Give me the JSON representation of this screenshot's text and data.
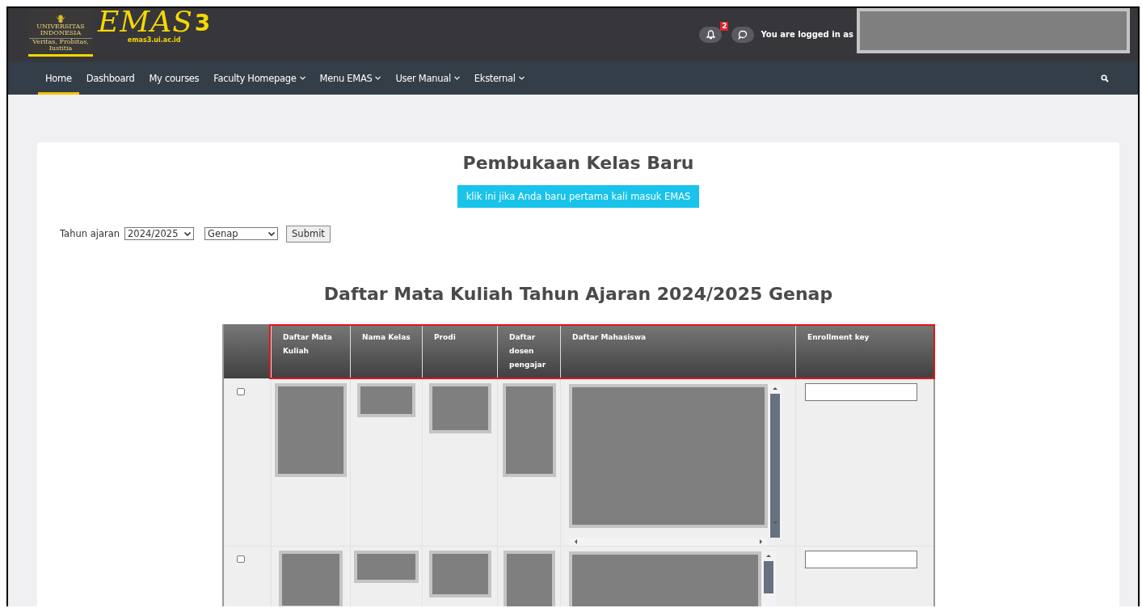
{
  "header": {
    "emblem_lines": [
      "UNIVERSITAS INDONESIA",
      "Veritas, Probitas, Iustitia"
    ],
    "logo_text": "EMAS",
    "logo_number": "3",
    "logo_url": "emas3.ui.ac.id",
    "notification_count": "2",
    "login_text": "You are logged in as"
  },
  "nav": {
    "items": [
      {
        "label": "Home",
        "selected": true,
        "has_dropdown": false
      },
      {
        "label": "Dashboard",
        "selected": false,
        "has_dropdown": false
      },
      {
        "label": "My courses",
        "selected": false,
        "has_dropdown": false
      },
      {
        "label": "Faculty Homepage",
        "selected": false,
        "has_dropdown": true
      },
      {
        "label": "Menu EMAS",
        "selected": false,
        "has_dropdown": true
      },
      {
        "label": "User Manual",
        "selected": false,
        "has_dropdown": true
      },
      {
        "label": "Eksternal",
        "selected": false,
        "has_dropdown": true
      }
    ]
  },
  "page": {
    "title": "Pembukaan Kelas Baru",
    "first_time_button": "klik ini jika Anda baru pertama kali masuk EMAS",
    "filter": {
      "label": "Tahun ajaran",
      "year": "2024/2025",
      "semester": "Genap",
      "submit": "Submit"
    },
    "section_title": "Daftar Mata Kuliah Tahun Ajaran 2024/2025 Genap"
  },
  "table": {
    "columns": [
      "Daftar Mata Kuliah",
      "Nama Kelas",
      "Prodi",
      "Daftar dosen pengajar",
      "Daftar Mahasiswa",
      "Enrollment key"
    ],
    "rows": [
      {
        "checked": false,
        "enrollment_key": ""
      },
      {
        "checked": false,
        "enrollment_key": ""
      }
    ]
  }
}
